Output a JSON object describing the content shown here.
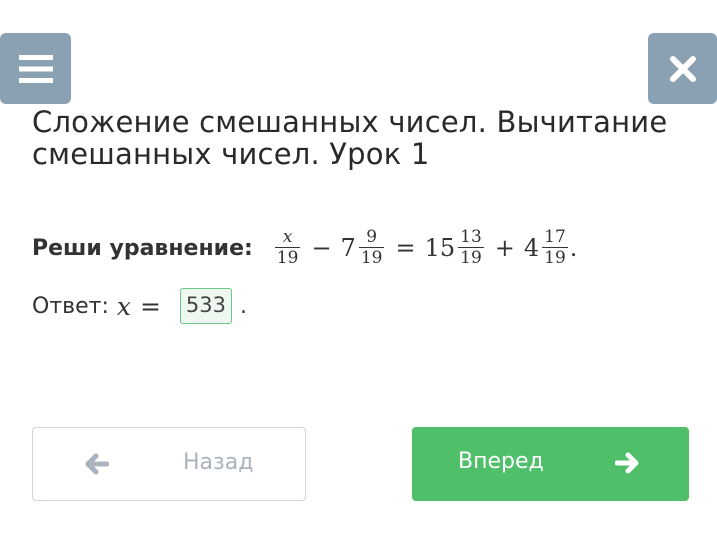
{
  "header": {
    "menu_icon": "hamburger-menu-icon",
    "close_icon": "close-icon"
  },
  "lesson": {
    "title": "Сложение смешанных чисел. Вычитание смешанных чисел. Урок 1"
  },
  "task": {
    "label": "Реши уравнение:",
    "equation": {
      "term1_num": "x",
      "term1_den": "19",
      "op1": "−",
      "term2_whole": "7",
      "term2_num": "9",
      "term2_den": "19",
      "eq": "=",
      "term3_whole": "15",
      "term3_num": "13",
      "term3_den": "19",
      "op2": "+",
      "term4_whole": "4",
      "term4_num": "17",
      "term4_den": "19",
      "end": "."
    }
  },
  "answer": {
    "label": "Ответ:",
    "variable": "x",
    "eq": "=",
    "value": "533",
    "end": "."
  },
  "navigation": {
    "back_label": "Назад",
    "next_label": "Вперед"
  },
  "colors": {
    "top_buttons": "#8aa0b3",
    "next_button": "#4fbf6a",
    "back_border": "#cfd6dc",
    "input_border": "#6cc58a"
  }
}
